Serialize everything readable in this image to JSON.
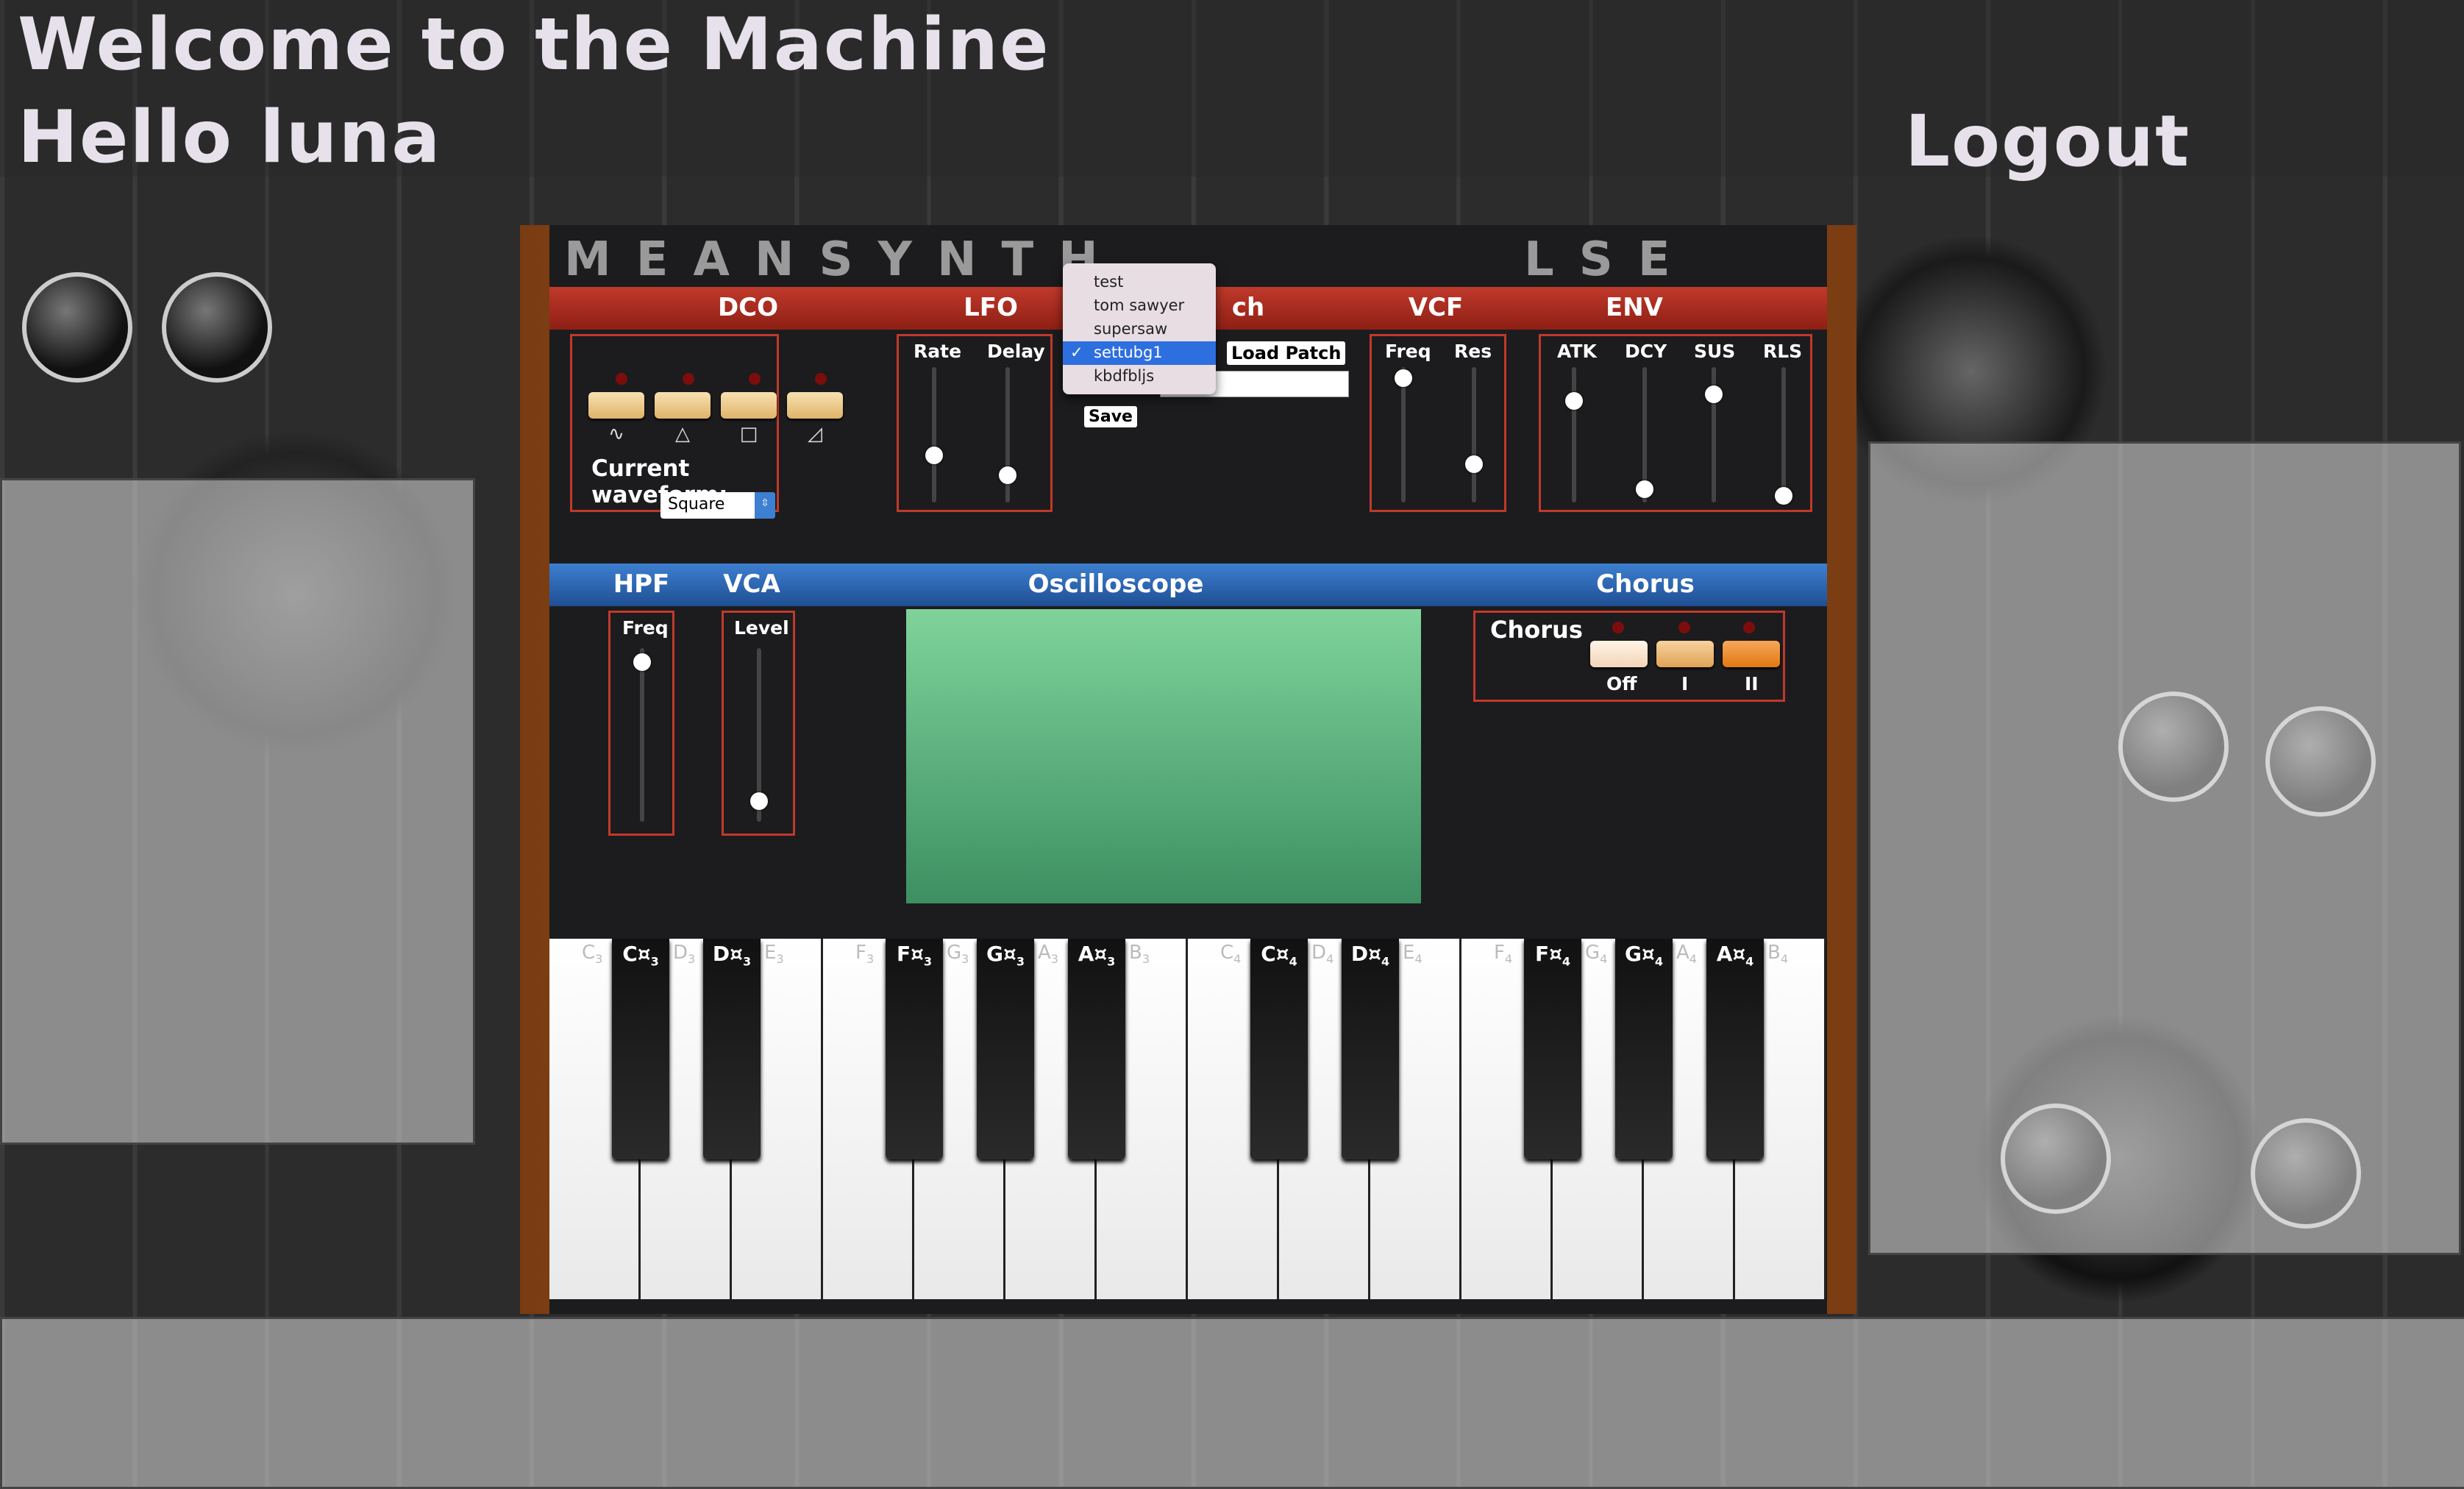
{
  "header": {
    "welcome": "Welcome to the Machine",
    "greeting": "Hello luna",
    "logout": "Logout"
  },
  "synth": {
    "brand_left": "MEANSYNTH",
    "brand_right": "LSE",
    "sections_top": {
      "dco": "DCO",
      "lfo": "LFO",
      "patch_suffix": "ch",
      "vcf": "VCF",
      "env": "ENV"
    },
    "sections_bottom": {
      "hpf": "HPF",
      "vca": "VCA",
      "scope": "Oscilloscope",
      "chorus": "Chorus"
    },
    "dco": {
      "waveform_glyphs": [
        "∿",
        "△",
        "□",
        "◿"
      ],
      "current_label": "Current waveform:",
      "current_value": "Square"
    },
    "lfo": {
      "rate": "Rate",
      "delay": "Delay",
      "rate_level": 0.35,
      "delay_level": 0.2
    },
    "vcf": {
      "freq": "Freq",
      "res": "Res",
      "freq_level": 0.92,
      "res_level": 0.28
    },
    "env": {
      "atk": "ATK",
      "dcy": "DCY",
      "sus": "SUS",
      "rls": "RLS",
      "atk_level": 0.75,
      "dcy_level": 0.1,
      "sus_level": 0.8,
      "rls_level": 0.05
    },
    "hpf": {
      "freq": "Freq",
      "freq_level": 0.92
    },
    "vca": {
      "level": "Level",
      "level_value": 0.12
    },
    "chorus": {
      "title": "Chorus",
      "buttons": [
        "Off",
        "I",
        "II"
      ],
      "active": "II"
    },
    "patch": {
      "load_label": "Load Patch",
      "save_label": "Save",
      "options": [
        "test",
        "tom sawyer",
        "supersaw",
        "settubg1",
        "kbdfbljs"
      ],
      "selected": "settubg1",
      "check": "✓"
    },
    "keyboard": {
      "white": [
        "C",
        "D",
        "E",
        "F",
        "G",
        "A",
        "B",
        "C",
        "D",
        "E",
        "F",
        "G",
        "A",
        "B"
      ],
      "white_oct": [
        "3",
        "3",
        "3",
        "3",
        "3",
        "3",
        "3",
        "4",
        "4",
        "4",
        "4",
        "4",
        "4",
        "4"
      ],
      "black": [
        "C¤",
        "D¤",
        "F¤",
        "G¤",
        "A¤",
        "C¤",
        "D¤",
        "F¤",
        "G¤",
        "A¤"
      ],
      "black_oct": [
        "3",
        "3",
        "3",
        "3",
        "3",
        "4",
        "4",
        "4",
        "4",
        "4"
      ]
    }
  },
  "colors": {
    "red_bar": "#c0392b",
    "blue_bar": "#3d7fd0",
    "wood": "#9c5220",
    "scope": "#6fcf90"
  }
}
